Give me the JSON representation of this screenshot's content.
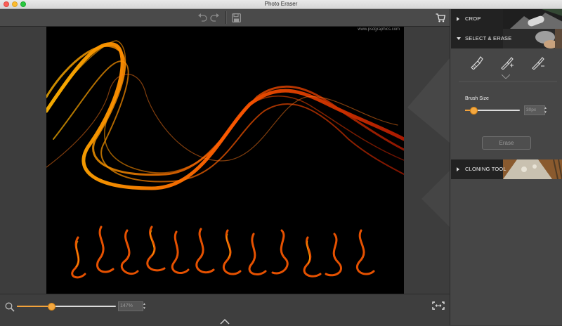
{
  "window": {
    "title": "Photo Eraser"
  },
  "toolbar": {
    "undo": "undo-icon",
    "redo": "redo-icon",
    "save": "save-icon",
    "cart": "cart-icon"
  },
  "canvas": {
    "watermark": "www.psdgraphics.com"
  },
  "zoom": {
    "value": "147%",
    "level": 0.35
  },
  "panel": {
    "sections": [
      {
        "label": "CROP",
        "expanded": false
      },
      {
        "label": "SELECT & ERASE",
        "expanded": true
      },
      {
        "label": "CLONING TOOL",
        "expanded": false
      }
    ],
    "tools": [
      "brush-icon",
      "brush-plus-icon",
      "brush-minus-icon"
    ],
    "brush": {
      "label": "Brush Size",
      "value": "30px",
      "level": 0.15
    },
    "erase_label": "Erase"
  },
  "colors": {
    "accent": "#f4a83f",
    "flame": "#ff6a00",
    "panel_bg": "#464646"
  }
}
